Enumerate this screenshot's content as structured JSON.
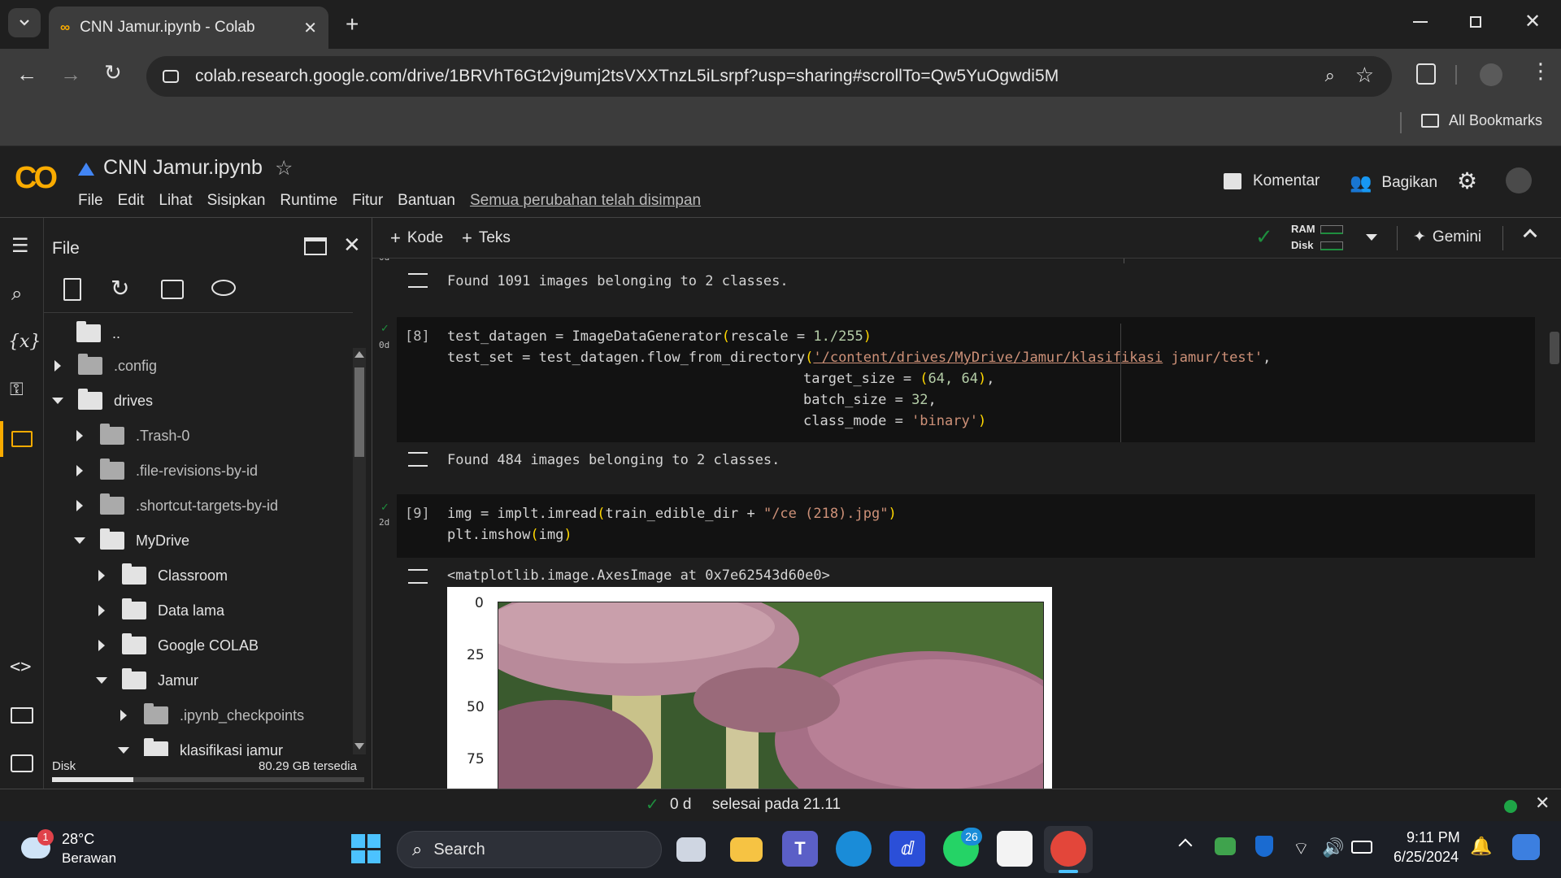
{
  "browser": {
    "tab_title": "CNN Jamur.ipynb - Colab",
    "url": "colab.research.google.com/drive/1BRVhT6Gt2vj9umj2tsVXXTnzL5iLsrpf?usp=sharing#scrollTo=Qw5YuOgwdi5M",
    "bookmarks_label": "All Bookmarks"
  },
  "colab": {
    "logo_text": "CO",
    "notebook_title": "CNN Jamur.ipynb",
    "menu": [
      "File",
      "Edit",
      "Lihat",
      "Sisipkan",
      "Runtime",
      "Fitur",
      "Bantuan"
    ],
    "saved_status": "Semua perubahan telah disimpan",
    "comment_label": "Komentar",
    "share_label": "Bagikan",
    "add_code_label": "Kode",
    "add_text_label": "Teks",
    "ram_label": "RAM",
    "disk_label": "Disk",
    "gemini_label": "Gemini"
  },
  "file_panel": {
    "title": "File",
    "parent_dir": "..",
    "tree": [
      {
        "label": ".config",
        "depth": 0,
        "expanded": false
      },
      {
        "label": "drives",
        "depth": 0,
        "expanded": true
      },
      {
        "label": ".Trash-0",
        "depth": 1,
        "expanded": false
      },
      {
        "label": ".file-revisions-by-id",
        "depth": 1,
        "expanded": false
      },
      {
        "label": ".shortcut-targets-by-id",
        "depth": 1,
        "expanded": false
      },
      {
        "label": "MyDrive",
        "depth": 1,
        "expanded": true
      },
      {
        "label": "Classroom",
        "depth": 2,
        "expanded": false
      },
      {
        "label": "Data lama",
        "depth": 2,
        "expanded": false
      },
      {
        "label": "Google COLAB",
        "depth": 2,
        "expanded": false
      },
      {
        "label": "Jamur",
        "depth": 2,
        "expanded": true
      },
      {
        "label": ".ipynb_checkpoints",
        "depth": 3,
        "expanded": false
      },
      {
        "label": "klasifikasi jamur",
        "depth": 3,
        "expanded": true
      }
    ],
    "disk_label": "Disk",
    "disk_free": "80.29 GB tersedia",
    "disk_used_fraction": 0.26
  },
  "notebook": {
    "out1": "Found 1091 images belonging to 2 classes.",
    "cell8": {
      "count": "[8]",
      "status": "0d",
      "line1_a": "test_datagen = ImageDataGenerator",
      "line1_b": "rescale = ",
      "line1_c": "1./255",
      "line2_a": "test_set = test_datagen.flow_from_directory",
      "line2_str1": "'/content/drives/MyDrive/Jamur/klasifikasi",
      "line2_str2": " jamur/test'",
      "line3": "target_size = ",
      "line3_v": "64, 64",
      "line4": "batch_size = ",
      "line4_v": "32",
      "line5": "class_mode = ",
      "line5_v": "'binary'"
    },
    "out2": "Found 484 images belonging to 2 classes.",
    "cell9": {
      "count": "[9]",
      "status": "2d",
      "line1_a": "img = implt.imread",
      "line1_b": "train_edible_dir + ",
      "line1_str": "\"/ce (218).jpg\"",
      "line2_a": "plt.imshow",
      "line2_b": "img"
    },
    "out3": "<matplotlib.image.AxesImage at 0x7e62543d60e0>",
    "y_ticks": [
      "0",
      "25",
      "50",
      "75"
    ]
  },
  "statusbar": {
    "time": "0 d",
    "text": "selesai pada 21.11"
  },
  "taskbar": {
    "weather_temp": "28°C",
    "weather_desc": "Berawan",
    "weather_badge": "1",
    "search_label": "Search",
    "whatsapp_badge": "26",
    "clock_time": "9:11 PM",
    "clock_date": "6/25/2024"
  }
}
